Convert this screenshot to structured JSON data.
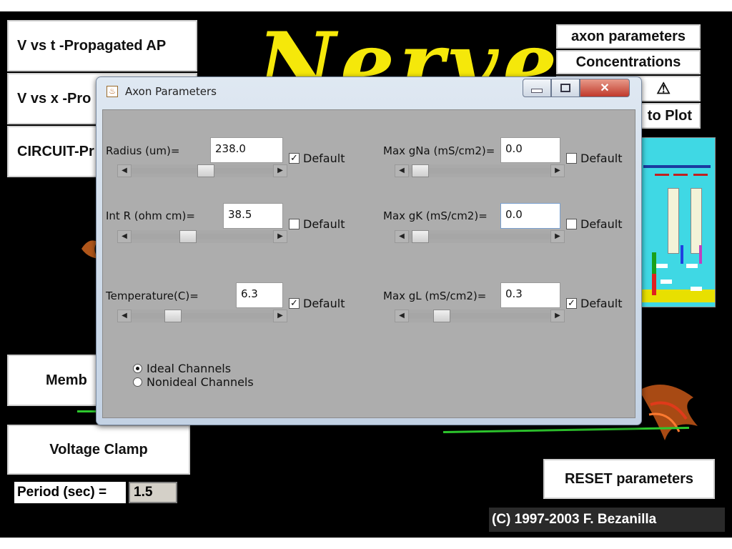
{
  "app": {
    "logo_text": "Nerve",
    "left_buttons": [
      "V vs t  -Propagated AP",
      "V vs x -Pro",
      "CIRCUIT-Pr",
      "Memb",
      "Voltage Clamp"
    ],
    "right_buttons": [
      "axon parameters",
      "Concentrations",
      "to Plot"
    ],
    "period_label": "Period (sec) =",
    "period_value": "1.5",
    "reset_button": "RESET parameters",
    "copyright": "(C) 1997-2003 F. Bezanilla"
  },
  "dialog": {
    "title": "Axon Parameters",
    "params": [
      {
        "label": "Radius (um)=",
        "value": "238.0",
        "default_label": "Default",
        "default_checked": true,
        "slider_pos": 0.43
      },
      {
        "label": "Int R (ohm cm)=",
        "value": "38.5",
        "default_label": "Default",
        "default_checked": false,
        "slider_pos": 0.38
      },
      {
        "label": "Temperature(C)=",
        "value": "6.3",
        "default_label": "Default",
        "default_checked": true,
        "slider_pos": 0.25
      },
      {
        "label": "Max gNa (mS/cm2)=",
        "value": "0.0",
        "default_label": "Default",
        "default_checked": false,
        "slider_pos": 0.0
      },
      {
        "label": "Max gK (mS/cm2)=",
        "value": "0.0",
        "default_label": "Default",
        "default_checked": false,
        "slider_pos": 0.0
      },
      {
        "label": "Max gL (mS/cm2)=",
        "value": "0.3",
        "default_label": "Default",
        "default_checked": true,
        "slider_pos": 0.2
      }
    ],
    "channels": [
      {
        "label": "Ideal Channels",
        "selected": true
      },
      {
        "label": "Nonideal Channels",
        "selected": false
      }
    ]
  },
  "colors": {
    "background": "#000000",
    "logo": "#f5e80a",
    "dialog_panel": "#adadad",
    "close_button": "#c0392b",
    "trace": "#2ec82e"
  }
}
